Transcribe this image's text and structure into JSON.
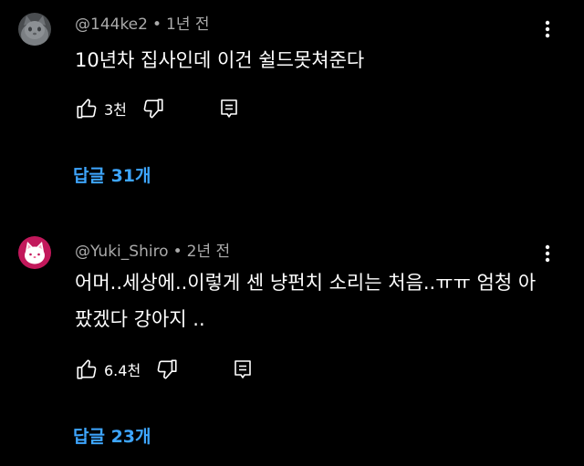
{
  "comments": [
    {
      "author": "@144ke2",
      "time": "1년 전",
      "text": "10년차 집사인데 이건 쉴드못쳐준다",
      "likes": "3천",
      "replies": "답글 31개",
      "avatar_icon": "gray-cat-avatar"
    },
    {
      "author": "@Yuki_Shiro",
      "time": "2년 전",
      "text": "어머..세상에..이렇게 센 냥펀치 소리는 처음..ㅠㅠ 엄청 아팠겠다 강아지 ..",
      "likes": "6.4천",
      "replies": "답글 23개",
      "avatar_icon": "white-cat-avatar"
    }
  ],
  "separator": "•",
  "colors": {
    "background": "#000000",
    "meta_text": "#aaaaaa",
    "reply_link": "#3ea6ff",
    "avatar_pink": "#c2185b"
  }
}
